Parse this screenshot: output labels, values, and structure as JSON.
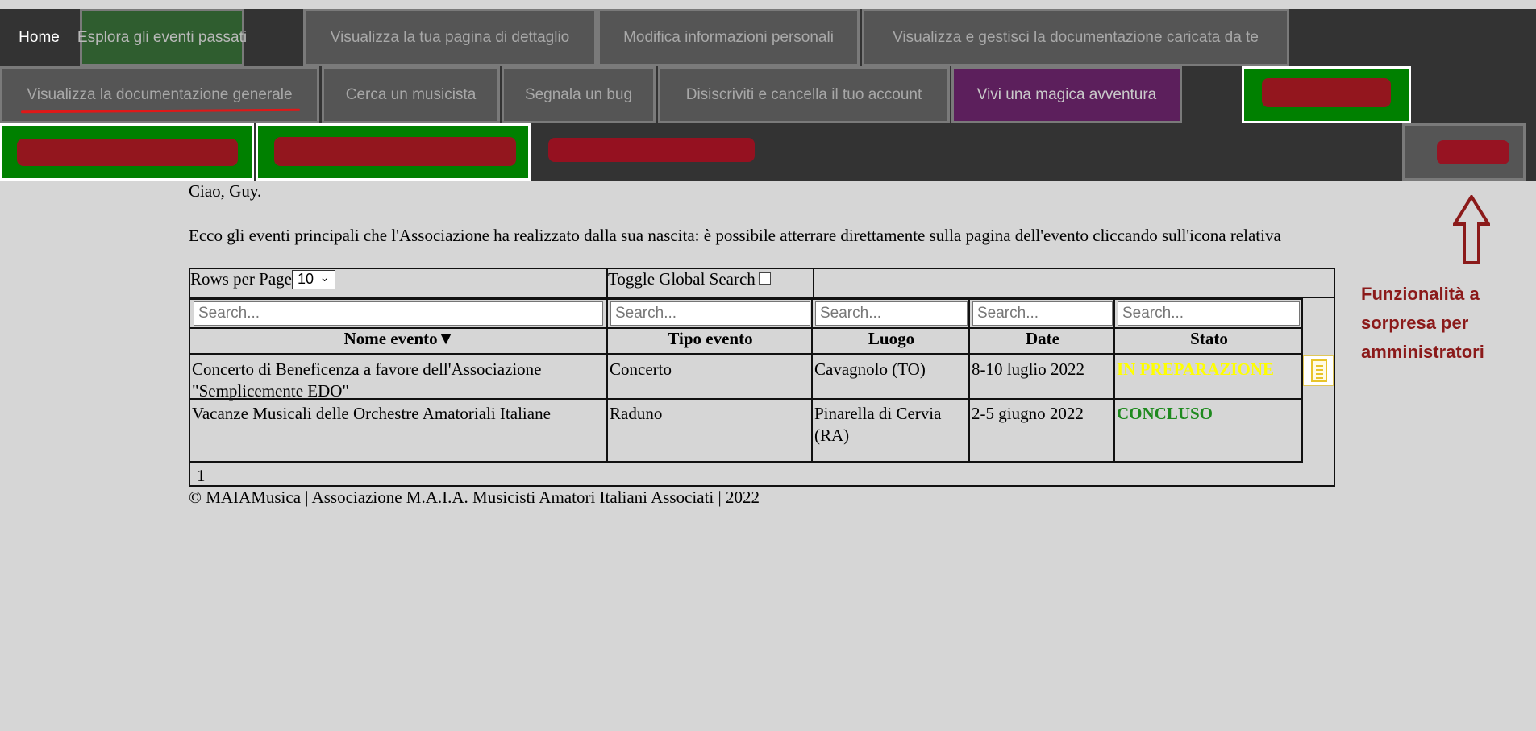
{
  "nav": {
    "row1": [
      "Home",
      "Esplora gli eventi passati",
      "Visualizza la tua pagina di dettaglio",
      "Modifica informazioni personali",
      "Visualizza e gestisci la documentazione caricata da te"
    ],
    "row2": [
      "Visualizza la documentazione generale",
      "Cerca un musicista",
      "Segnala un bug",
      "Disiscriviti e cancella il tuo account",
      "Vivi una magica avventura"
    ],
    "colors": {
      "bar": "#333333",
      "green": "#008000",
      "purple": "#5c1f5c",
      "redaction": "#9b1020",
      "underline": "#e01818"
    }
  },
  "greeting": "Ciao, Guy.",
  "intro": "Ecco gli eventi principali che l'Associazione ha realizzato dalla sua nascita: è possibile atterrare direttamente sulla pagina dell'evento cliccando sull'icona relativa",
  "table": {
    "rows_per_page_label": "Rows per Page",
    "rows_per_page_value": "10",
    "toggle_label": "Toggle Global Search",
    "search_placeholder": "Search...",
    "headers": [
      "Nome evento",
      "Tipo evento",
      "Luogo",
      "Date",
      "Stato"
    ],
    "rows": [
      {
        "nome": "Concerto di Beneficenza a favore dell'Associazione \"Semplicemente EDO\"",
        "tipo": "Concerto",
        "luogo": "Cavagnolo (TO)",
        "date": "8-10 luglio 2022",
        "stato": "IN PREPARAZIONE",
        "stato_color": "#ffff00"
      },
      {
        "nome": "Vacanze Musicali delle Orchestre Amatoriali Italiane",
        "tipo": "Raduno",
        "luogo": "Pinarella di Cervia (RA)",
        "date": "2-5 giugno 2022",
        "stato": "CONCLUSO",
        "stato_color": "#1e8a1e"
      }
    ],
    "page": "1"
  },
  "footer": "© MAIAMusica | Associazione M.A.I.A. Musicisti Amatori Italiani Associati | 2022",
  "annotation": {
    "text_lines": [
      "Funzionalità a",
      "sorpresa per",
      "amministratori"
    ],
    "color": "#8b1a1a"
  }
}
